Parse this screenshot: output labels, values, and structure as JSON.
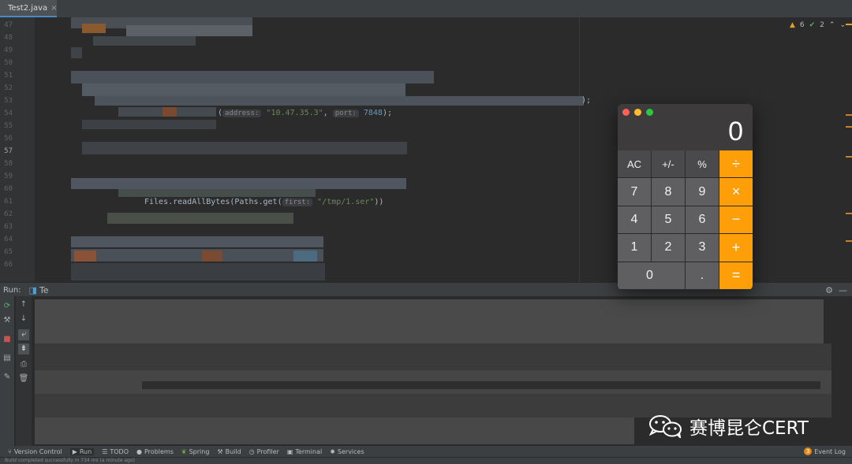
{
  "editor": {
    "tab_label": "Test2.java",
    "tab_close": "×",
    "line_numbers": [
      "47",
      "48",
      "49",
      "50",
      "51",
      "52",
      "53",
      "54",
      "55",
      "56",
      "57",
      "58",
      "59",
      "60",
      "61",
      "62",
      "63",
      "64",
      "65",
      "66"
    ],
    "line54": {
      "hint_address": "address:",
      "str_address": "\"10.47.35.3\"",
      "hint_port": "port:",
      "num_port": "7848",
      "tail": ");"
    },
    "line53_tail": ");",
    "line61": {
      "code": "Files.readAllBytes(Paths.get(",
      "hint_first": "first:",
      "str": "\"/tmp/1.ser\"",
      "tail": "))"
    },
    "inspections": {
      "warnings": "6",
      "ok": "2"
    }
  },
  "run_panel": {
    "label": "Run:",
    "config": "Te"
  },
  "toolwindows": [
    {
      "icon": "version-control-icon",
      "label": "Version Control"
    },
    {
      "icon": "run-icon",
      "label": "Run"
    },
    {
      "icon": "todo-icon",
      "label": "TODO"
    },
    {
      "icon": "problems-icon",
      "label": "Problems"
    },
    {
      "icon": "spring-icon",
      "label": "Spring"
    },
    {
      "icon": "build-icon",
      "label": "Build"
    },
    {
      "icon": "profiler-icon",
      "label": "Profiler"
    },
    {
      "icon": "terminal-icon",
      "label": "Terminal"
    },
    {
      "icon": "services-icon",
      "label": "Services"
    }
  ],
  "event_log": {
    "count": "3",
    "label": "Event Log"
  },
  "status_text": "Build completed successfully in 734 ms (a minute ago)",
  "calculator": {
    "display": "0",
    "keys": [
      [
        "AC",
        "+/-",
        "%",
        "÷"
      ],
      [
        "7",
        "8",
        "9",
        "×"
      ],
      [
        "4",
        "5",
        "6",
        "−"
      ],
      [
        "1",
        "2",
        "3",
        "+"
      ],
      [
        "0",
        ".",
        "="
      ]
    ],
    "colors": {
      "operator": "#fe9f0a",
      "function": "#4a4a4c",
      "digit": "#5f5f61",
      "close": "#fe5f57",
      "minimize": "#febc2e",
      "maximize": "#28c840"
    }
  },
  "watermark": {
    "text": "赛博昆仑CERT"
  }
}
